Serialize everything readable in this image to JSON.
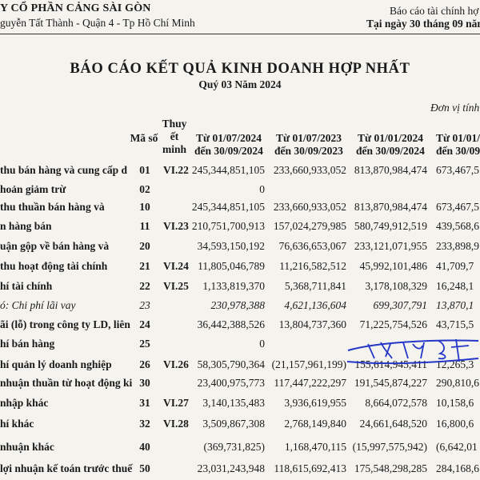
{
  "header": {
    "company": "Y CỔ PHẦN CẢNG SÀI GÒN",
    "address": "guyễn Tất Thành - Quận 4 - Tp Hồ Chí Minh",
    "report_type": "Báo cáo tài chính hợ",
    "as_of": "Tại ngày 30 tháng 09 năm"
  },
  "title": "BÁO CÁO KẾT QUẢ KINH DOANH HỢP NHẤT",
  "subtitle": "Quý 03 Năm 2024",
  "unit": "Đơn vị tính",
  "columns": {
    "code": "Mã số",
    "note_line1": "Thuy",
    "note_line2": "ết",
    "note_line3": "minh",
    "c1_line1": "Từ 01/07/2024",
    "c1_line2": "đến 30/09/2024",
    "c2_line1": "Từ 01/07/2023",
    "c2_line2": "đến 30/09/2023",
    "c3_line1": "Từ 01/01/2024",
    "c3_line2": "đến 30/09/2024",
    "c4_line1": "Từ 01/01/2",
    "c4_line2": "đến 30/09/"
  },
  "rows": [
    {
      "label": "thu bán hàng và cung cấp d",
      "code": "01",
      "note": "VI.22",
      "c1": "245,344,851,105",
      "c2": "233,660,933,052",
      "c3": "813,870,984,474",
      "c4": "673,467,5"
    },
    {
      "label": "hoản giảm trừ",
      "code": "02",
      "note": "",
      "c1": "0",
      "c2": "",
      "c3": "",
      "c4": ""
    },
    {
      "label": "thu thuần bán hàng và",
      "code": "10",
      "note": "",
      "c1": "245,344,851,105",
      "c2": "233,660,933,052",
      "c3": "813,870,984,474",
      "c4": "673,467,5"
    },
    {
      "label": "n hàng bán",
      "code": "11",
      "note": "VI.23",
      "c1": "210,751,700,913",
      "c2": "157,024,279,985",
      "c3": "580,749,912,519",
      "c4": "439,568,6"
    },
    {
      "label": "uận gộp về bán hàng và",
      "code": "20",
      "note": "",
      "c1": "34,593,150,192",
      "c2": "76,636,653,067",
      "c3": "233,121,071,955",
      "c4": "233,898,9"
    },
    {
      "label": "thu hoạt động tài chính",
      "code": "21",
      "note": "VI.24",
      "c1": "11,805,046,789",
      "c2": "11,216,582,512",
      "c3": "45,992,101,486",
      "c4": "41,709,7"
    },
    {
      "label": "hí tài chính",
      "code": "22",
      "note": "VI.25",
      "c1": "1,133,819,370",
      "c2": "5,368,711,841",
      "c3": "3,178,108,329",
      "c4": "16,248,1"
    },
    {
      "label": "ó: Chi phí lãi vay",
      "code": "23",
      "note": "",
      "c1": "230,978,388",
      "c2": "4,621,136,604",
      "c3": "699,307,791",
      "c4": "13,870,1"
    },
    {
      "label": "ãi (lỗ) trong công ty LD, liên",
      "code": "24",
      "note": "",
      "c1": "36,442,388,526",
      "c2": "13,804,737,360",
      "c3": "71,225,754,526",
      "c4": "43,715,5"
    },
    {
      "label": "hí bán hàng",
      "code": "25",
      "note": "",
      "c1": "0",
      "c2": "",
      "c3": "",
      "c4": ""
    },
    {
      "label": "hí quản lý doanh nghiệp",
      "code": "26",
      "note": "VI.26",
      "c1": "58,305,790,364",
      "c2": "(21,157,961,199)",
      "c3": "155,614,945,411",
      "c4": "12,265,3"
    },
    {
      "label": "nhuận thuần từ hoạt động ki",
      "code": "30",
      "note": "",
      "c1": "23,400,975,773",
      "c2": "117,447,222,297",
      "c3": "191,545,874,227",
      "c4": "290,810,6"
    },
    {
      "label": "nhập khác",
      "code": "31",
      "note": "VI.27",
      "c1": "3,140,135,483",
      "c2": "3,936,619,955",
      "c3": "8,664,072,578",
      "c4": "10,158,6"
    },
    {
      "label": "hí khác",
      "code": "32",
      "note": "VI.28",
      "c1": "3,509,867,308",
      "c2": "2,768,149,840",
      "c3": "24,661,648,520",
      "c4": "16,800,6"
    },
    {
      "label": "nhuận khác",
      "code": "40",
      "note": "",
      "c1": "(369,731,825)",
      "c2": "1,168,470,115",
      "c3": "(15,997,575,942)",
      "c4": "(6,642,01"
    },
    {
      "label": "lợi nhuận kế toán trước thuế",
      "code": "50",
      "note": "",
      "c1": "23,031,243,948",
      "c2": "118,615,692,413",
      "c3": "175,548,298,285",
      "c4": "284,168,6"
    }
  ]
}
